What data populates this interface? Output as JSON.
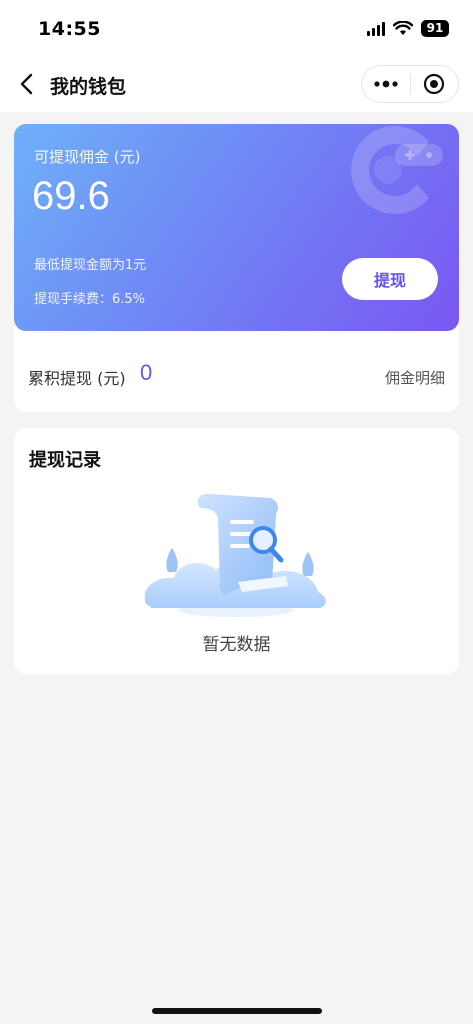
{
  "status_bar": {
    "time": "14:55",
    "battery": "91"
  },
  "nav": {
    "title": "我的钱包"
  },
  "wallet": {
    "available_label": "可提现佣金 (元)",
    "available_amount": "69.6",
    "min_text": "最低提现金额为1元",
    "fee_text": "提现手续费：6.5%",
    "withdraw_label": "提现",
    "cumulative_label": "累积提现 (元)",
    "cumulative_value": "0",
    "detail_label": "佣金明细"
  },
  "records": {
    "title": "提现记录",
    "empty_text": "暂无数据"
  },
  "colors": {
    "accent": "#6a55e5",
    "gradient_start": "#6fb0f8",
    "gradient_end": "#7a57f2",
    "background": "#f4f4f4"
  },
  "icons": [
    "cellular-signal-icon",
    "wifi-icon",
    "battery-icon",
    "back-arrow-icon",
    "more-dots-icon",
    "close-target-icon",
    "brand-logo-icon",
    "empty-document-illustration"
  ]
}
